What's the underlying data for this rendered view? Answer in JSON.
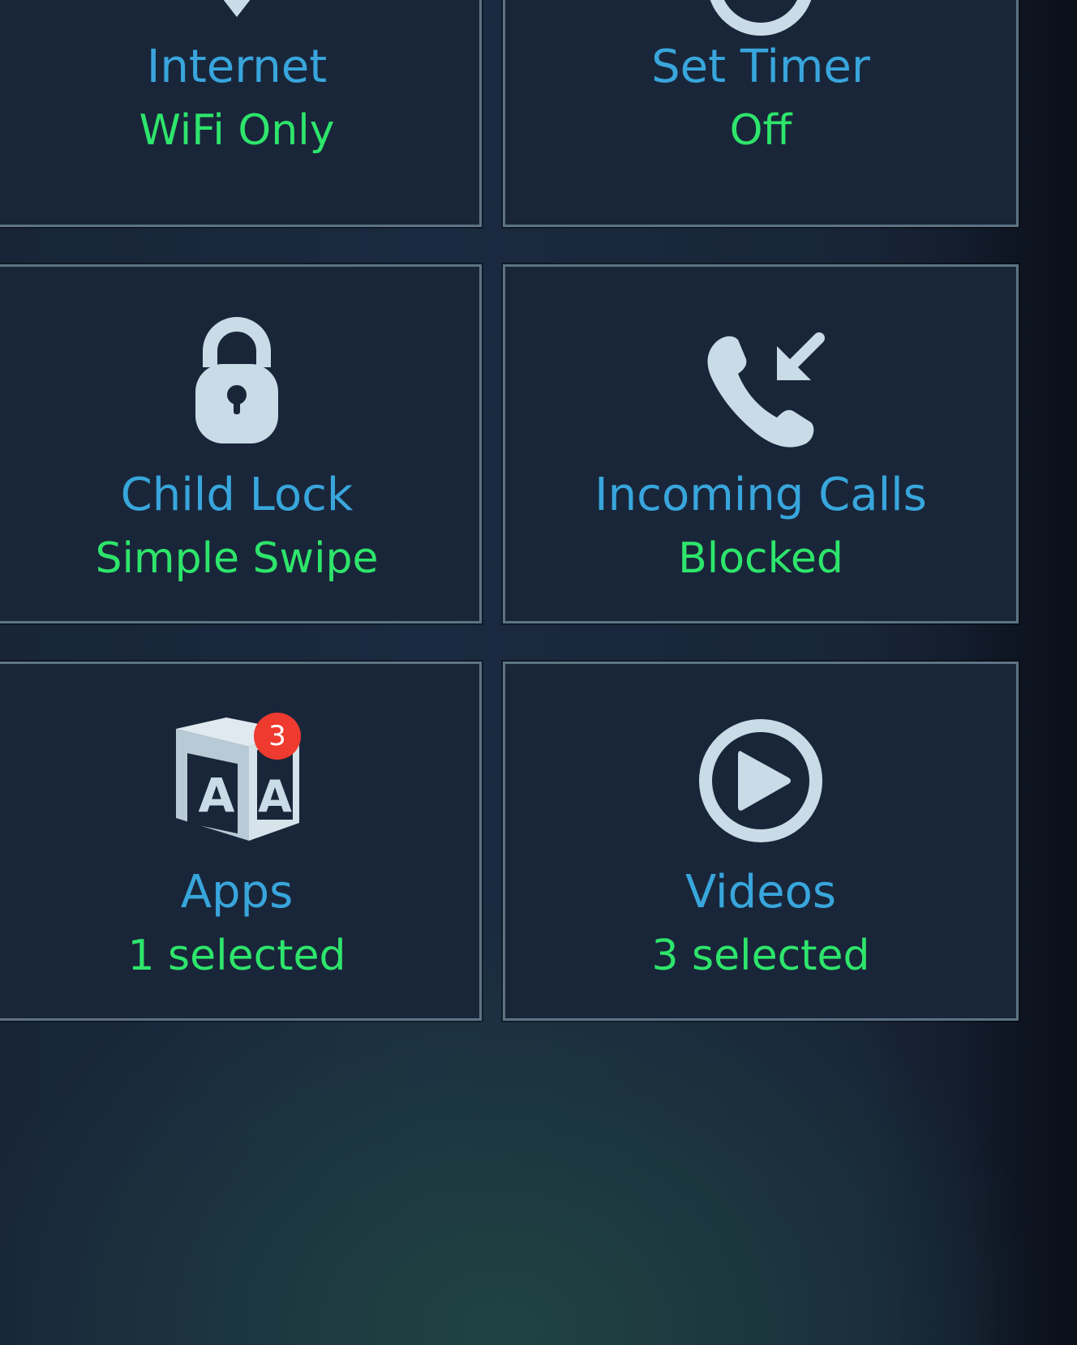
{
  "tiles": {
    "internet": {
      "icon": "wifi-icon",
      "title": "Internet",
      "value": "WiFi Only"
    },
    "timer": {
      "icon": "timer-icon",
      "title": "Set Timer",
      "value": "Off"
    },
    "child_lock": {
      "icon": "lock-icon",
      "title": "Child Lock",
      "value": "Simple Swipe"
    },
    "incoming_calls": {
      "icon": "incoming-call-icon",
      "title": "Incoming Calls",
      "value": "Blocked"
    },
    "apps": {
      "icon": "alphabet-block-icon",
      "title": "Apps",
      "value": "1 selected",
      "badge": "3"
    },
    "videos": {
      "icon": "play-circle-icon",
      "title": "Videos",
      "value": "3 selected"
    }
  },
  "colors": {
    "title": "#38a6dc",
    "value": "#2ee56b",
    "icon": "#c9dbe6",
    "badge": "#ee3a2f",
    "tile_border": "#5d7384"
  }
}
